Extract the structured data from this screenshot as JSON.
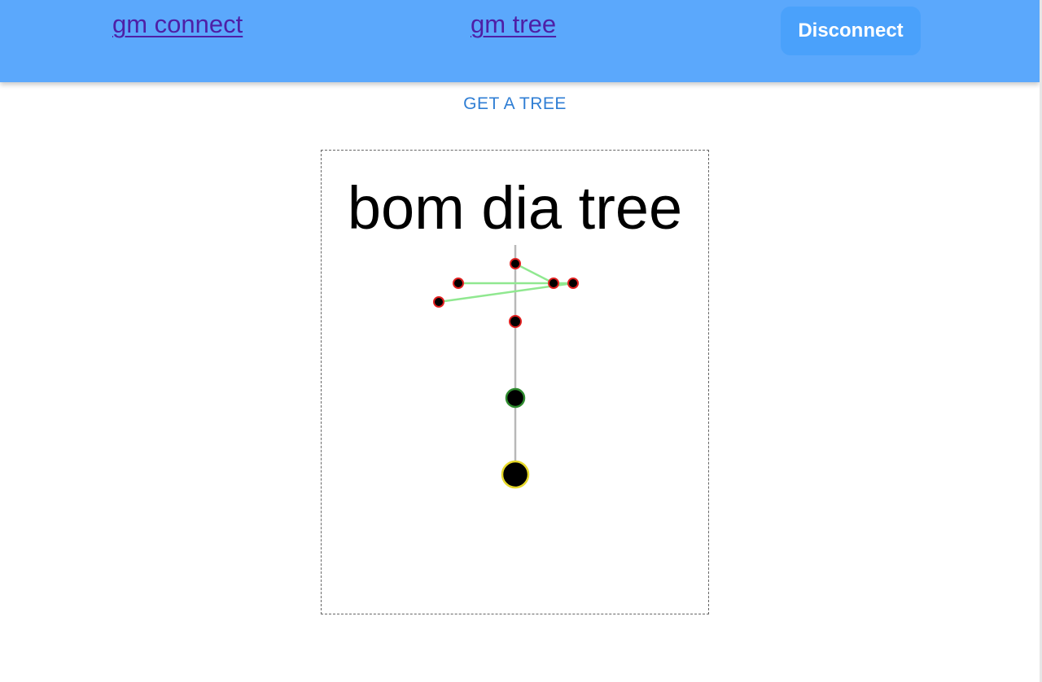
{
  "nav": {
    "connect_label": "gm connect",
    "tree_label": "gm tree",
    "disconnect_label": "Disconnect"
  },
  "actions": {
    "get_tree_label": "GET A TREE"
  },
  "tree": {
    "title": "bom dia tree"
  },
  "colors": {
    "navbar": "#5ba8fc",
    "link": "#4e1fa6",
    "button": "#4aa1fb",
    "accent_text": "#2f7ed4",
    "branch": "#90e890",
    "node_outline": "#e02020",
    "trunk": "#b8b8b8",
    "middle_node_outline": "#2e8b2e",
    "root_node_outline": "#e6d82a"
  }
}
